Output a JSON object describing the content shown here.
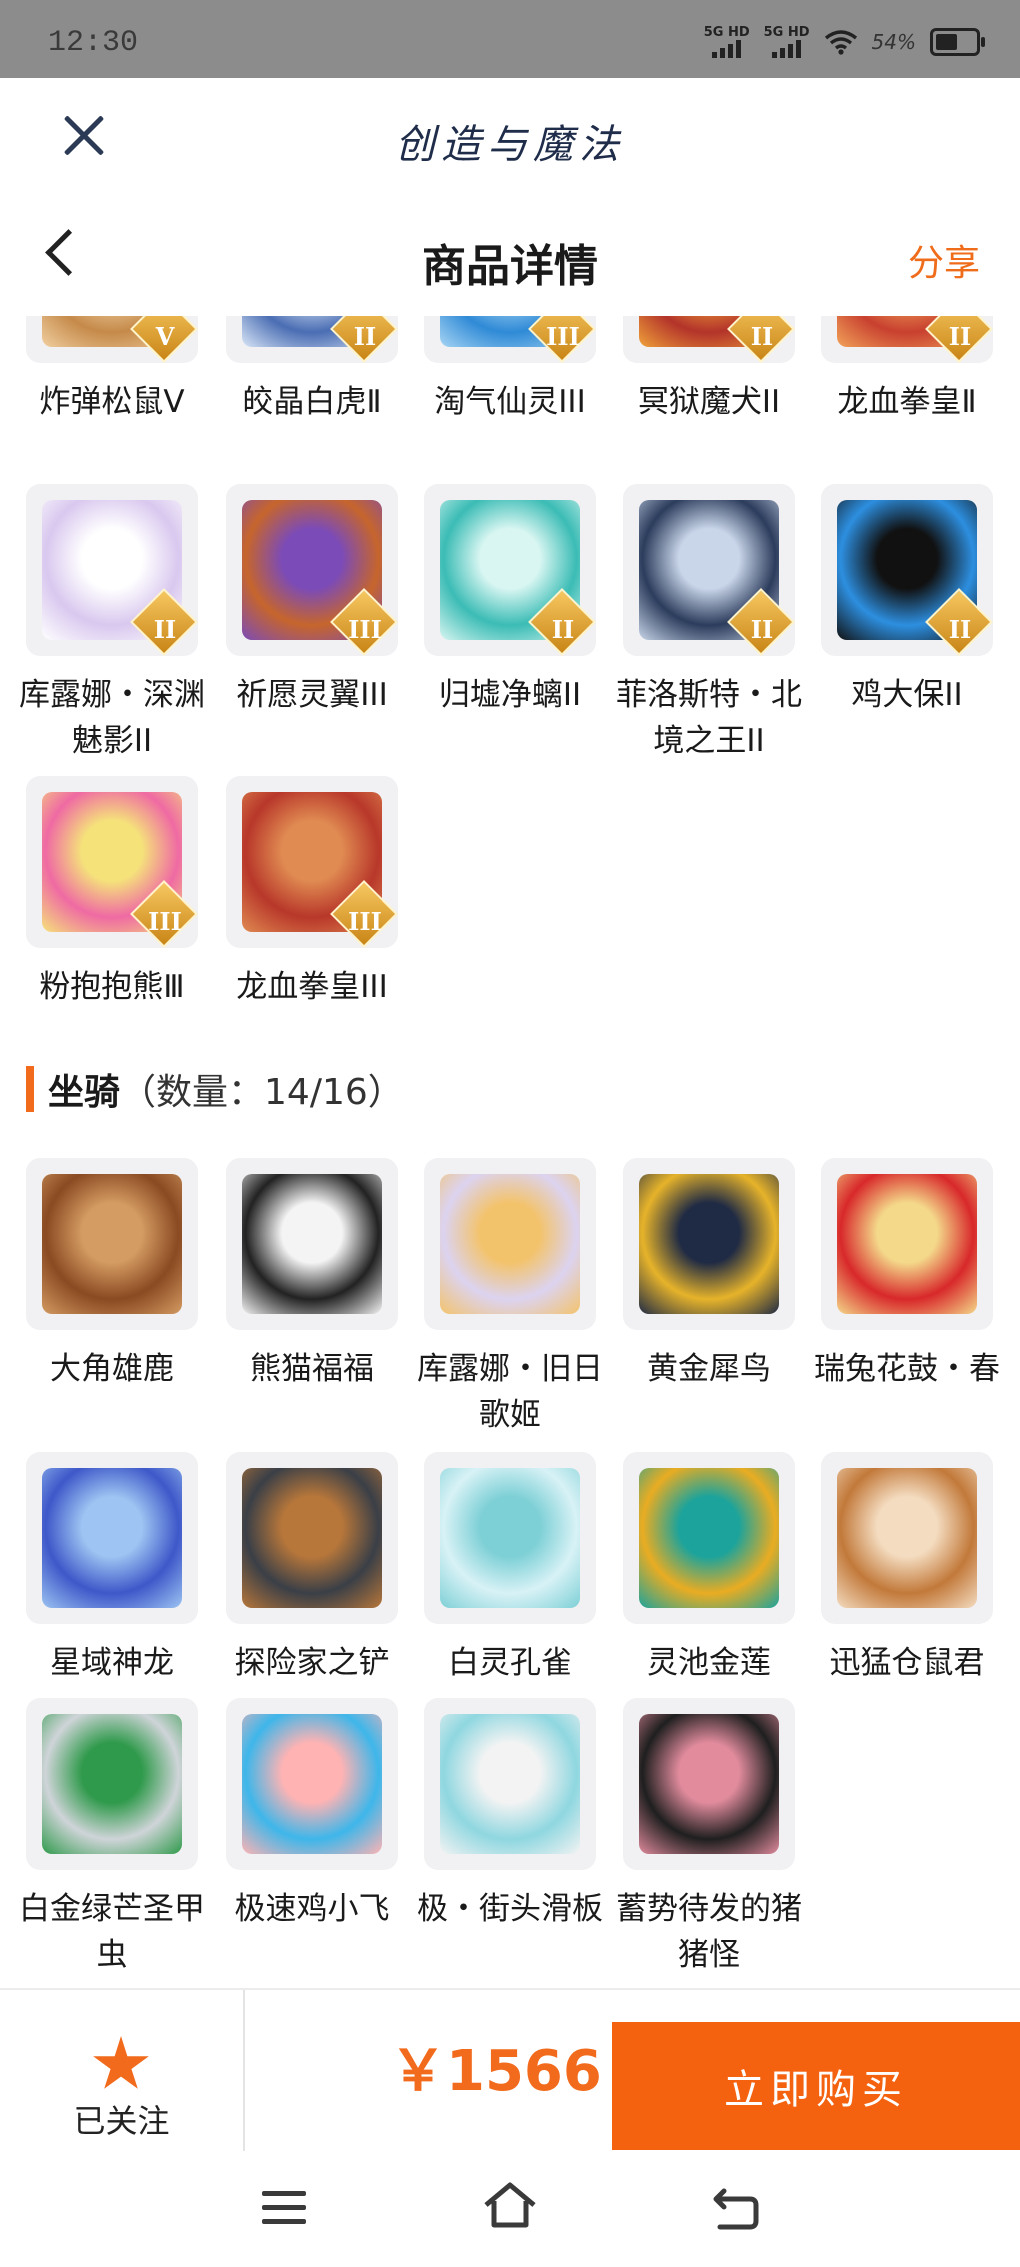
{
  "status_bar": {
    "time": "12:30",
    "net1": "5G HD",
    "net2": "5G HD",
    "battery_text": "54%",
    "battery_level": 0.54
  },
  "app_header": {
    "title": "创造与魔法"
  },
  "nav": {
    "title": "商品详情",
    "share_label": "分享"
  },
  "pets_section": {
    "items": [
      {
        "label": "炸弹松鼠Ⅴ",
        "badge": "V",
        "color": "#c58a4a",
        "color2": "#f1cfa0"
      },
      {
        "label": "皎晶白虎Ⅱ",
        "badge": "II",
        "color": "#4a6db3",
        "color2": "#d9e6f7"
      },
      {
        "label": "淘气仙灵III",
        "badge": "III",
        "color": "#2f8ad6",
        "color2": "#a7d5f4"
      },
      {
        "label": "冥狱魔犬II",
        "badge": "II",
        "color": "#b3332a",
        "color2": "#f0a23a"
      },
      {
        "label": "龙血拳皇Ⅱ",
        "badge": "II",
        "color": "#c8402f",
        "color2": "#f2a35a"
      },
      {
        "label": "库露娜・深渊魅影II",
        "badge": "II",
        "color": "#d9c8ef",
        "color2": "#ffffff"
      },
      {
        "label": "祈愿灵翼III",
        "badge": "III",
        "color": "#c6652c",
        "color2": "#7b4bb8"
      },
      {
        "label": "归墟净螭II",
        "badge": "II",
        "color": "#3bbcb5",
        "color2": "#d9f6f2"
      },
      {
        "label": "菲洛斯特・北境之王II",
        "badge": "II",
        "color": "#2c3c5c",
        "color2": "#c9d6ea"
      },
      {
        "label": "鸡大保II",
        "badge": "II",
        "color": "#2d8fe0",
        "color2": "#111111"
      },
      {
        "label": "粉抱抱熊Ⅲ",
        "badge": "III",
        "color": "#ef6aa3",
        "color2": "#f5e37a"
      },
      {
        "label": "龙血拳皇III",
        "badge": "III",
        "color": "#b8372a",
        "color2": "#e08b52"
      }
    ]
  },
  "mount_section": {
    "title": "坐骑",
    "count_text": "（数量：14/16）",
    "items": [
      {
        "label": "大角雄鹿",
        "color": "#8a4a22",
        "color2": "#d49b62"
      },
      {
        "label": "熊猫福福",
        "color": "#222222",
        "color2": "#f4f4f4"
      },
      {
        "label": "库露娜・旧日歌姬",
        "color": "#dcd3f0",
        "color2": "#f3c36c"
      },
      {
        "label": "黄金犀鸟",
        "color": "#e6b32a",
        "color2": "#1f2a44"
      },
      {
        "label": "瑞兔花鼓・春",
        "color": "#d8282a",
        "color2": "#f4d98a"
      },
      {
        "label": "星域神龙",
        "color": "#3e58c9",
        "color2": "#9dc4f2"
      },
      {
        "label": "探险家之铲",
        "color": "#3a3f47",
        "color2": "#b8773a"
      },
      {
        "label": "白灵孔雀",
        "color": "#d8f2f6",
        "color2": "#7dd0d6"
      },
      {
        "label": "灵池金莲",
        "color": "#e9ac22",
        "color2": "#1ba39c"
      },
      {
        "label": "迅猛仓鼠君",
        "color": "#c2793a",
        "color2": "#f4dcc0"
      },
      {
        "label": "白金绿芒圣甲虫",
        "color": "#cfd4d8",
        "color2": "#2f9a4b"
      },
      {
        "label": "极速鸡小飞",
        "color": "#3eb6ea",
        "color2": "#ffb3b3"
      },
      {
        "label": "极・街头滑板",
        "color": "#8fd7e0",
        "color2": "#f3f3f3"
      },
      {
        "label": "蓄势待发的猪猪怪",
        "color": "#1f1f1f",
        "color2": "#e18b9d"
      }
    ]
  },
  "bottom_bar": {
    "follow_label": "已关注",
    "price": "￥1566",
    "buy_label": "立即购买"
  },
  "colors": {
    "accent": "#f26b1d",
    "buy": "#f4610f"
  },
  "icons": {
    "close": "close-icon",
    "back": "back-arrow-icon",
    "star": "star-icon",
    "menu": "menu-icon",
    "home": "home-icon",
    "sys_back": "return-icon"
  }
}
